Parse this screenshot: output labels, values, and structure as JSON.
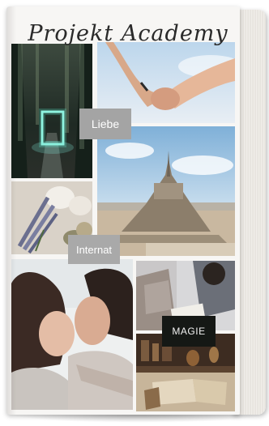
{
  "book": {
    "title": "Projekt Academy"
  },
  "labels": {
    "love": "Liebe",
    "boarding_school": "Internat",
    "magic": "MAGIE"
  },
  "photos": [
    "forest-neon-portal",
    "holding-hands",
    "lavender-candles",
    "mont-saint-michel",
    "embracing-couple",
    "students-studying",
    "magic-books-potions"
  ],
  "colors": {
    "label_light": "#a4a4a4",
    "label_dark": "#151815",
    "cover_bg": "#f7f6f4"
  }
}
